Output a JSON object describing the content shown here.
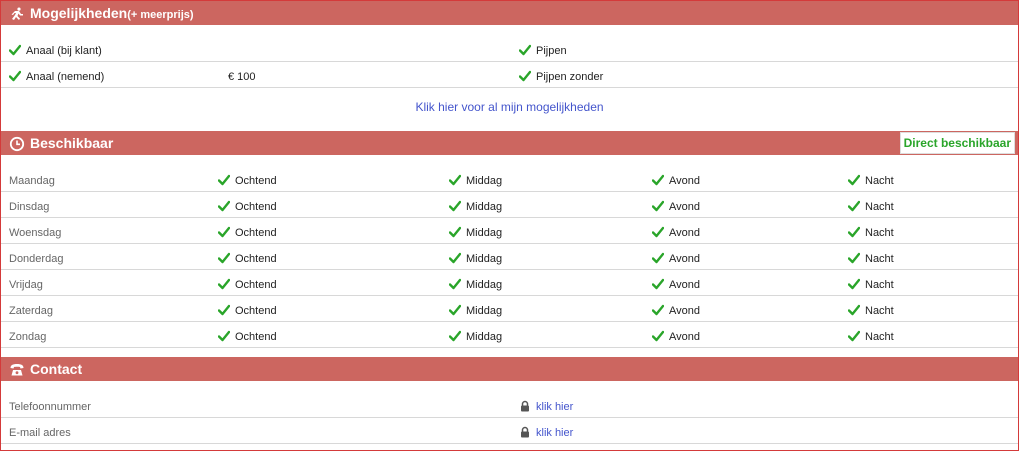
{
  "options": {
    "title": "Mogelijkheden",
    "subtitle": "(+ meerprijs)",
    "rows": [
      {
        "left": "Anaal (bij klant)",
        "price": "",
        "right": "Pijpen"
      },
      {
        "left": "Anaal (nemend)",
        "price": "€ 100",
        "right": "Pijpen zonder"
      }
    ],
    "more_link": "Klik hier voor al mijn mogelijkheden"
  },
  "availability": {
    "title": "Beschikbaar",
    "direct_label": "Direct beschikbaar",
    "slots": [
      "Ochtend",
      "Middag",
      "Avond",
      "Nacht"
    ],
    "days": [
      "Maandag",
      "Dinsdag",
      "Woensdag",
      "Donderdag",
      "Vrijdag",
      "Zaterdag",
      "Zondag"
    ]
  },
  "contact": {
    "title": "Contact",
    "rows": [
      {
        "label": "Telefoonnummer",
        "link": "klik hier"
      },
      {
        "label": "E-mail adres",
        "link": "klik hier"
      }
    ]
  },
  "colors": {
    "header_bg": "#cc6660",
    "check": "#2aa52a",
    "link": "#4455cc"
  }
}
